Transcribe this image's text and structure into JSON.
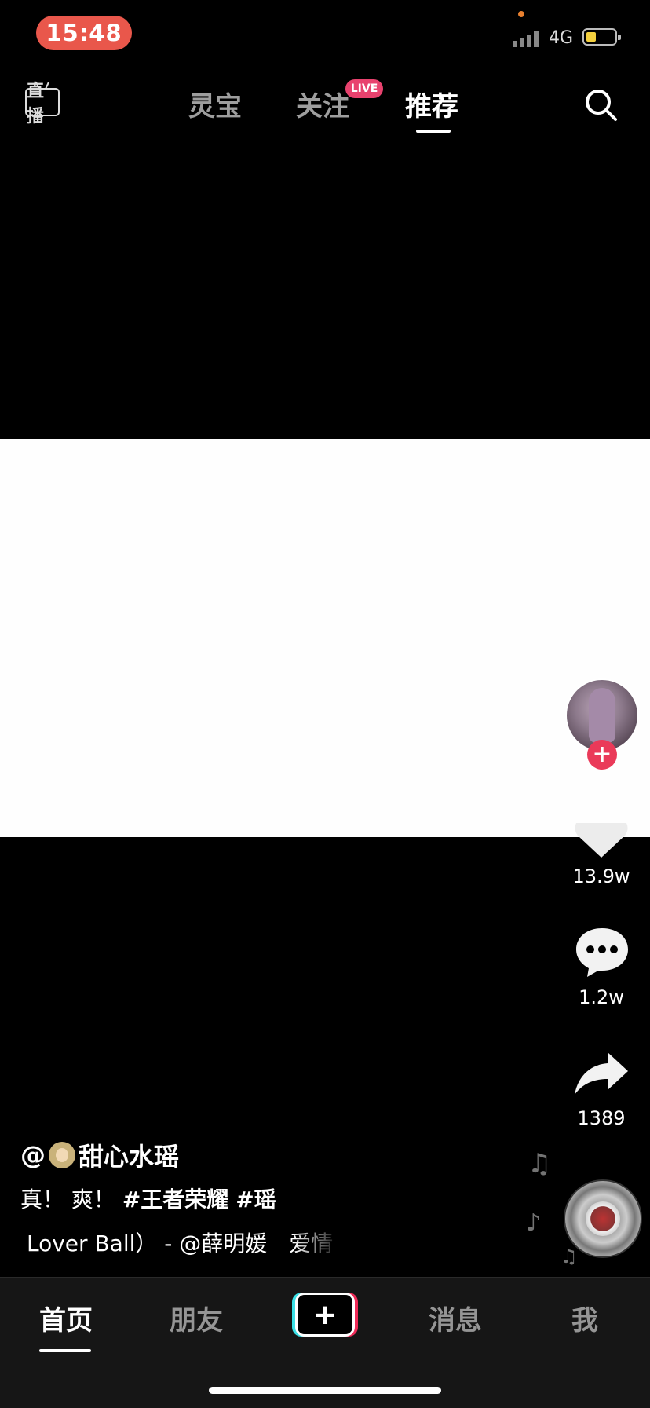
{
  "status_bar": {
    "time": "15:48",
    "network": "4G",
    "battery_level": 0.35,
    "signal_bars": 4
  },
  "top_nav": {
    "live_icon_label": "直播",
    "tabs": [
      {
        "label": "灵宝",
        "active": false
      },
      {
        "label": "关注",
        "active": false,
        "badge": "LIVE"
      },
      {
        "label": "推荐",
        "active": true
      }
    ],
    "search_icon": "search-icon"
  },
  "actions": {
    "follow_symbol": "+",
    "likes": "13.9w",
    "comments": "1.2w",
    "shares": "1389"
  },
  "caption": {
    "author_prefix": "@",
    "author_name": "甜心水瑶",
    "desc_text": "真！ 爽！",
    "hashtags": [
      "#王者荣耀",
      "#瑶"
    ],
    "music": "Lover Ball） - @薛明媛　爱情"
  },
  "bottom_nav": {
    "items": [
      {
        "label": "首页",
        "active": true
      },
      {
        "label": "朋友",
        "active": false
      },
      {
        "label": "+",
        "type": "create"
      },
      {
        "label": "消息",
        "active": false
      },
      {
        "label": "我",
        "active": false
      }
    ]
  },
  "colors": {
    "time_pill": "#e9574b",
    "live_badge": "#e8426e",
    "follow_button": "#ea3a59",
    "plus_left": "#3ae0e6",
    "plus_right": "#ee2a57"
  }
}
